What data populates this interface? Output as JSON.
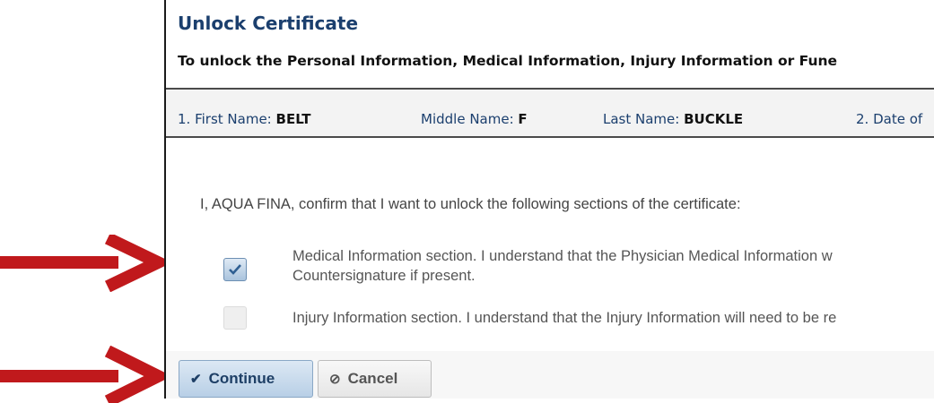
{
  "dialog": {
    "title": "Unlock Certificate",
    "instruction": "To unlock the Personal Information, Medical Information, Injury Information or Fune"
  },
  "name_bar": {
    "first_name_label": "1. First Name:",
    "first_name_value": "BELT",
    "middle_name_label": "Middle Name:",
    "middle_name_value": "F",
    "last_name_label": "Last Name:",
    "last_name_value": "BUCKLE",
    "date_label": "2. Date of"
  },
  "content": {
    "confirm_text": "I, AQUA FINA, confirm that I want to unlock the following sections of the certificate:",
    "options": [
      {
        "line1": "Medical Information section. I understand that the Physician Medical Information w",
        "line2": "Countersignature if present.",
        "checked": true
      },
      {
        "line1": "Injury Information section. I understand that the Injury Information will need to be re",
        "checked": false
      }
    ]
  },
  "buttons": {
    "continue_label": "Continue",
    "cancel_label": "Cancel"
  },
  "annotation": {
    "arrow_color": "#c0191c"
  },
  "colors": {
    "title": "#1b3f6e",
    "checkbox_checked": "#a9c3dd"
  }
}
